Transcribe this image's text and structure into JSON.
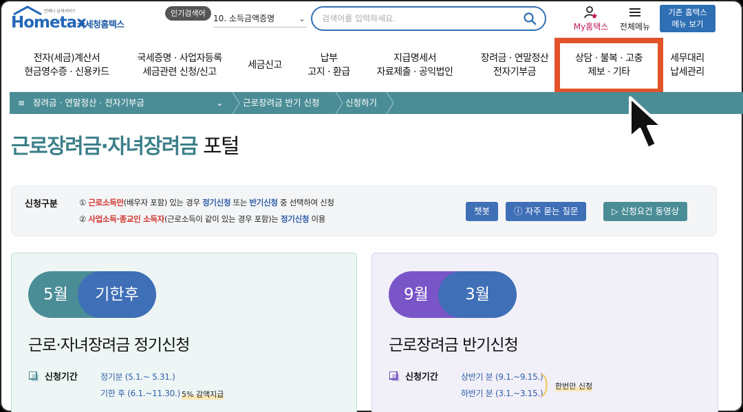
{
  "header": {
    "logo_brand": "Hometax",
    "logo_tagline": "언제나 납세서비스",
    "logo_kr": "국세청홈택스",
    "popular_badge": "인기검색어",
    "popular_selected": "10. 소득금액증명",
    "search_placeholder": "검색어를 입력하세요.",
    "my_hometax": "My홈택스",
    "all_menu": "전체메뉴",
    "legacy_line1": "기존 홈택스",
    "legacy_line2": "메뉴 보기"
  },
  "gnb": [
    {
      "l1": "전자(세금)계산서",
      "l2": "현금영수증 · 신용카드"
    },
    {
      "l1": "국세증명 · 사업자등록",
      "l2": "세금관련 신청/신고"
    },
    {
      "l1": "세금신고",
      "l2": ""
    },
    {
      "l1": "납부",
      "l2": "고지 · 환급"
    },
    {
      "l1": "지급명세서",
      "l2": "자료제출 · 공익법인"
    },
    {
      "l1": "장려금 · 연말정산",
      "l2": "전자기부금"
    },
    {
      "l1": "상담 · 불복 · 고충",
      "l2": "제보 · 기타"
    },
    {
      "l1": "세무대리",
      "l2": "납세관리"
    }
  ],
  "breadcrumb": {
    "menu": "장려금 · 연말정산 · 전자기부금",
    "sub": "근로장려금 반기 신청",
    "leaf": "신청하기"
  },
  "page_title": {
    "accent": "근로장려금·자녀장려금",
    "rest": "포털"
  },
  "info": {
    "label": "신청구분",
    "line1": {
      "num": "①",
      "red": "근로소득만",
      "t1": "(배우자 포함) 있는 경우",
      "b1": "정기신청",
      "t2": "또는",
      "b2": "반기신청",
      "t3": "중 선택하여 신청"
    },
    "line2": {
      "num": "②",
      "red": "사업소득·종교인 소득자",
      "t1": "(근로소득이 같이 있는 경우 포함)는",
      "b1": "정기신청",
      "t2": "이용"
    },
    "btn_chatbot": "챗봇",
    "btn_faq": "자주 묻는 질문",
    "btn_video": "신청요건 동영상"
  },
  "card1": {
    "left": "5월",
    "right": "기한후",
    "title": "근로·자녀장려금 정기신청",
    "period_label": "신청기간",
    "row1": "정기분 (5.1.~ 5.31.)",
    "row2": "기한 후 (6.1.~11.30.)",
    "row2_note": "5% 감액지급"
  },
  "card2": {
    "left": "9월",
    "right": "3월",
    "title": "근로장려금 반기신청",
    "period_label": "신청기간",
    "row1": "상반기 분 (9.1.~9.15.)",
    "row2": "하반기 분 (3.1.~3.15.)",
    "note": "한번만 신청"
  },
  "colors": {
    "primary_blue": "#2f6fb3",
    "teal": "#4b8d97",
    "highlight": "#e2532a",
    "red_text": "#d0342c"
  }
}
